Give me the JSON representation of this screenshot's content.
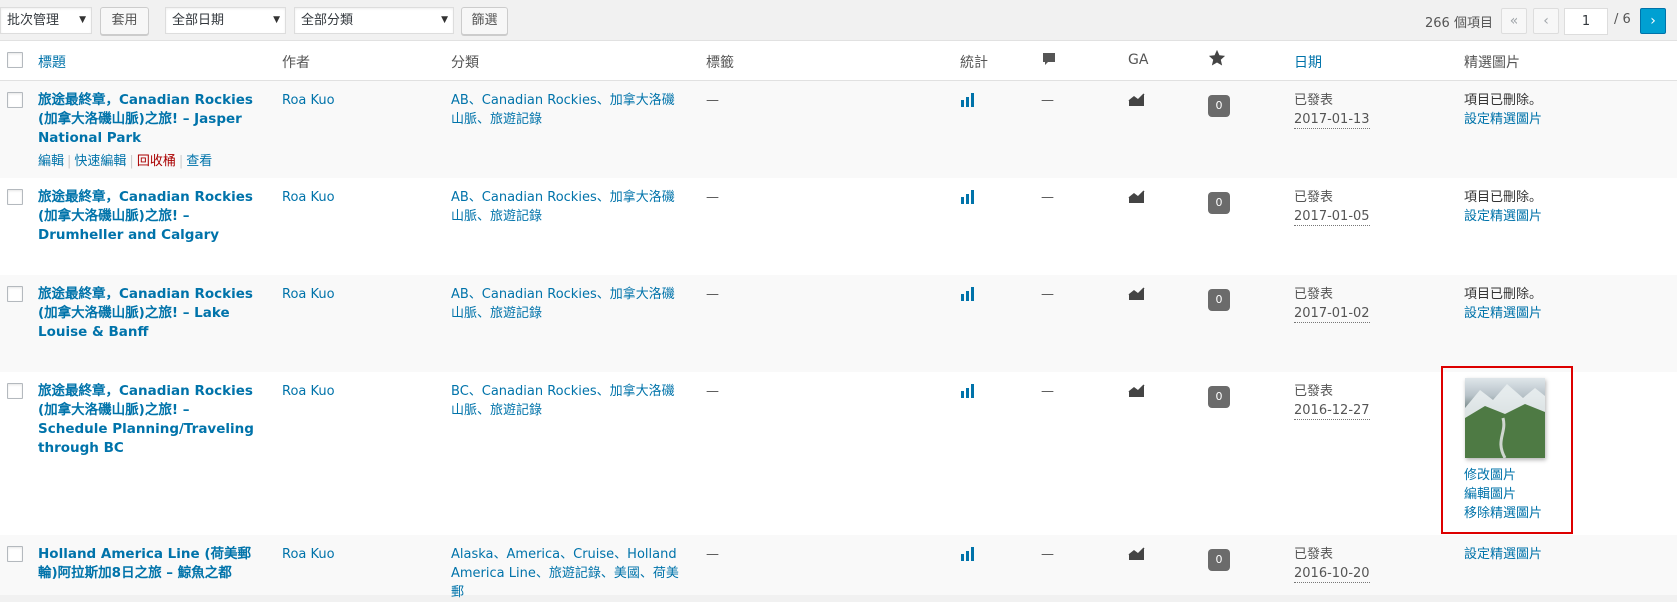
{
  "toolbar": {
    "bulk_actions": "批次管理",
    "apply": "套用",
    "all_dates": "全部日期",
    "all_categories": "全部分類",
    "filter": "篩選"
  },
  "pagination": {
    "total_items": "266 個項目",
    "first": "«",
    "prev": "‹",
    "current_page": "1",
    "total_pages": "/ 6",
    "next": "›"
  },
  "columns": {
    "title": "標題",
    "author": "作者",
    "categories": "分類",
    "tags": "標籤",
    "stats": "統計",
    "ga": "GA",
    "date": "日期",
    "featured_image": "精選圖片"
  },
  "posts": [
    {
      "title": "旅途最終章，Canadian Rockies (加拿大洛磯山脈)之旅! – Jasper National Park",
      "author": "Roa Kuo",
      "categories": "AB、Canadian Rockies、加拿大洛磯山脈、旅遊記錄",
      "tags": "—",
      "comments": "—",
      "views": "0",
      "status": "已發表",
      "date": "2017-01-13",
      "featured_text": "項目已刪除。",
      "featured_links": [
        "設定精選圖片"
      ]
    },
    {
      "title": "旅途最終章，Canadian Rockies (加拿大洛磯山脈)之旅! – Drumheller and Calgary",
      "author": "Roa Kuo",
      "categories": "AB、Canadian Rockies、加拿大洛磯山脈、旅遊記錄",
      "tags": "—",
      "comments": "—",
      "views": "0",
      "status": "已發表",
      "date": "2017-01-05",
      "featured_text": "項目已刪除。",
      "featured_links": [
        "設定精選圖片"
      ]
    },
    {
      "title": "旅途最終章，Canadian Rockies (加拿大洛磯山脈)之旅! – Lake Louise & Banff",
      "author": "Roa Kuo",
      "categories": "AB、Canadian Rockies、加拿大洛磯山脈、旅遊記錄",
      "tags": "—",
      "comments": "—",
      "views": "0",
      "status": "已發表",
      "date": "2017-01-02",
      "featured_text": "項目已刪除。",
      "featured_links": [
        "設定精選圖片"
      ]
    },
    {
      "title": "旅途最終章，Canadian Rockies (加拿大洛磯山脈)之旅! – Schedule Planning/Traveling through BC",
      "author": "Roa Kuo",
      "categories": "BC、Canadian Rockies、加拿大洛磯山脈、旅遊記錄",
      "tags": "—",
      "comments": "—",
      "views": "0",
      "status": "已發表",
      "date": "2016-12-27",
      "featured_text": "",
      "featured_links": [
        "修改圖片",
        "編輯圖片",
        "移除精選圖片"
      ]
    },
    {
      "title": "Holland America Line (荷美郵輪)阿拉斯加8日之旅 – 鯨魚之都",
      "author": "Roa Kuo",
      "categories": "Alaska、America、Cruise、Holland America Line、旅遊記錄、美國、荷美郵",
      "tags": "—",
      "comments": "—",
      "views": "0",
      "status": "已發表",
      "date": "2016-10-20",
      "featured_text": "",
      "featured_links": [
        "設定精選圖片"
      ]
    }
  ],
  "row_actions": {
    "edit": "編輯",
    "quick_edit": "快速編輯",
    "trash": "回收桶",
    "view": "查看"
  },
  "icons": {
    "stats": "bar-chart-icon",
    "ga": "area-chart-icon",
    "comments_header": "comment-bubble-icon",
    "star_header": "star-icon"
  },
  "colors": {
    "link": "#0073aa",
    "trash": "#a00",
    "highlight_box": "#dd0000",
    "next_btn": "#00a0d2"
  }
}
